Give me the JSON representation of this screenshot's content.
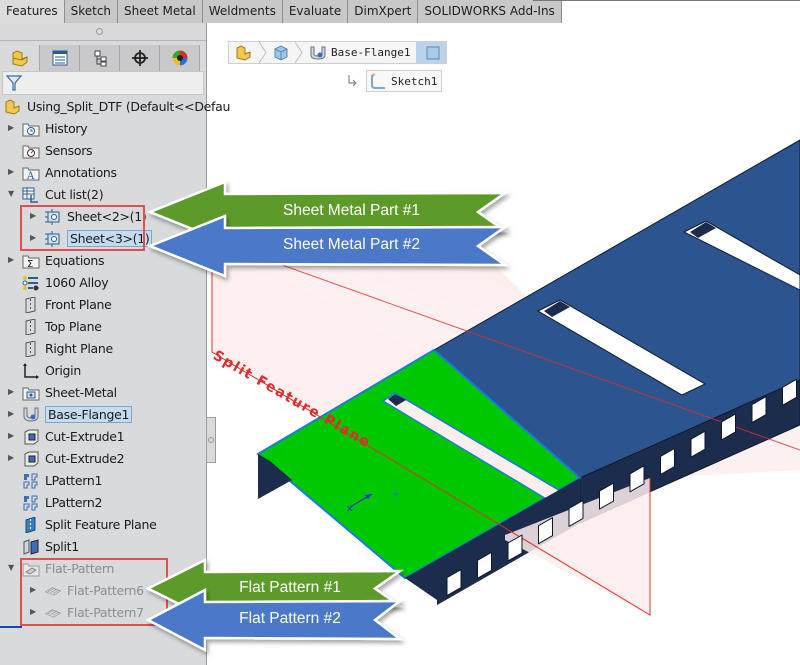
{
  "ribbon": {
    "tabs": [
      {
        "label": "Features",
        "active": true
      },
      {
        "label": "Sketch",
        "active": false
      },
      {
        "label": "Sheet Metal",
        "active": false
      },
      {
        "label": "Weldments",
        "active": false
      },
      {
        "label": "Evaluate",
        "active": false
      },
      {
        "label": "DimXpert",
        "active": false
      },
      {
        "label": "SOLIDWORKS Add-Ins",
        "active": false
      }
    ]
  },
  "panel": {
    "tabs": [
      {
        "icon": "featuremanager-icon"
      },
      {
        "icon": "propertymanager-icon"
      },
      {
        "icon": "configurationmanager-icon"
      },
      {
        "icon": "dimxpertmanager-icon"
      },
      {
        "icon": "displaymanager-icon"
      }
    ],
    "filter_icon": "filter-icon",
    "root": {
      "label": "Using_Split_DTF  (Default<<Defau"
    },
    "tree": [
      {
        "label": "History",
        "icon": "history-folder-icon",
        "expander": "collapsed"
      },
      {
        "label": "Sensors",
        "icon": "sensors-folder-icon",
        "expander": "none"
      },
      {
        "label": "Annotations",
        "icon": "annotations-folder-icon",
        "expander": "collapsed"
      },
      {
        "label": "Cut list(2)",
        "icon": "cut-list-icon",
        "expander": "expanded"
      },
      {
        "label": "Sheet<2>(1)",
        "icon": "sheet-body-icon",
        "expander": "collapsed",
        "indent": 1
      },
      {
        "label": "Sheet<3>(1)",
        "icon": "sheet-body-icon",
        "expander": "collapsed",
        "indent": 1,
        "selected": true
      },
      {
        "label": "Equations",
        "icon": "equations-folder-icon",
        "expander": "collapsed"
      },
      {
        "label": "1060 Alloy",
        "icon": "material-icon",
        "expander": "none"
      },
      {
        "label": "Front Plane",
        "icon": "plane-icon",
        "expander": "none"
      },
      {
        "label": "Top Plane",
        "icon": "plane-icon",
        "expander": "none"
      },
      {
        "label": "Right Plane",
        "icon": "plane-icon",
        "expander": "none"
      },
      {
        "label": "Origin",
        "icon": "origin-icon",
        "expander": "none"
      },
      {
        "label": "Sheet-Metal",
        "icon": "sheet-metal-folder-icon",
        "expander": "collapsed"
      },
      {
        "label": "Base-Flange1",
        "icon": "base-flange-icon",
        "expander": "collapsed",
        "selected": true
      },
      {
        "label": "Cut-Extrude1",
        "icon": "cut-extrude-icon",
        "expander": "collapsed"
      },
      {
        "label": "Cut-Extrude2",
        "icon": "cut-extrude-icon",
        "expander": "collapsed"
      },
      {
        "label": "LPattern1",
        "icon": "linear-pattern-icon",
        "expander": "none"
      },
      {
        "label": "LPattern2",
        "icon": "linear-pattern-icon",
        "expander": "none"
      },
      {
        "label": "Split Feature Plane",
        "icon": "split-plane-icon",
        "expander": "none"
      },
      {
        "label": "Split1",
        "icon": "split-icon",
        "expander": "none"
      },
      {
        "label": "Flat-Pattern",
        "icon": "flat-pattern-folder-icon",
        "expander": "expanded",
        "dim": true
      },
      {
        "label": "Flat-Pattern6",
        "icon": "flat-pattern-icon",
        "expander": "collapsed",
        "indent": 1,
        "dim": true
      },
      {
        "label": "Flat-Pattern7",
        "icon": "flat-pattern-icon",
        "expander": "collapsed",
        "indent": 1,
        "dim": true
      }
    ]
  },
  "breadcrumb": {
    "items": [
      {
        "icon": "part-icon"
      },
      {
        "icon": "solid-body-icon"
      },
      {
        "icon": "base-flange-icon",
        "label": "Base-Flange1"
      },
      {
        "icon": "face-icon"
      }
    ],
    "child": {
      "icon": "sketch-icon",
      "label": "Sketch1"
    }
  },
  "graphics": {
    "plane_label": "Split Feature Plane",
    "colors": {
      "part_top": "#2c548e",
      "part_side": "#1c2c4d",
      "selected_face": "#00c800",
      "selection_edge": "#1a7adf",
      "plane_fill": "#fdeeee",
      "plane_edge": "#e02c2c"
    }
  },
  "callouts": [
    {
      "label": "Sheet Metal Part #1",
      "color": "#5c9b2a"
    },
    {
      "label": "Sheet Metal Part #2",
      "color": "#4b78c8"
    },
    {
      "label": "Flat Pattern #1",
      "color": "#5c9b2a"
    },
    {
      "label": "Flat Pattern #2",
      "color": "#4b78c8"
    }
  ]
}
